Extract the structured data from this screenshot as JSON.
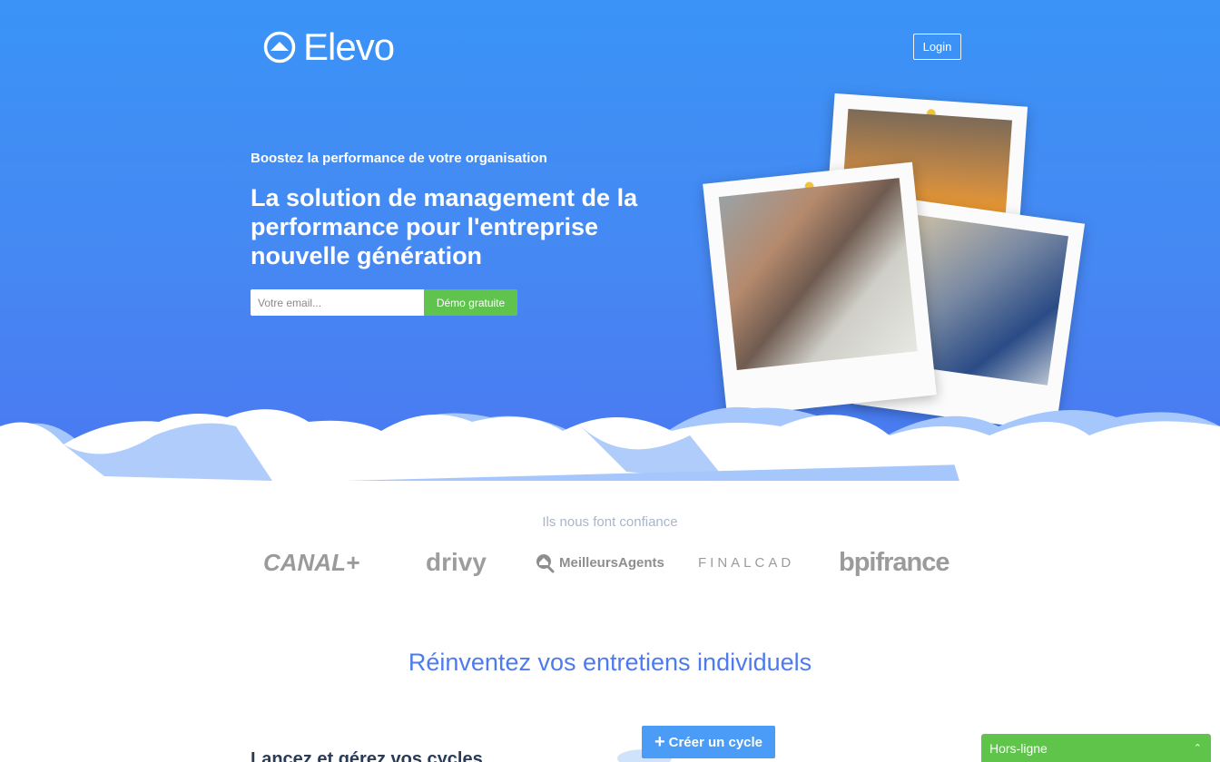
{
  "brand": {
    "name": "Elevo",
    "icon": "elevo-logo-icon"
  },
  "header": {
    "login_label": "Login"
  },
  "hero": {
    "tagline": "Boostez la performance de votre organisation",
    "headline": "La solution de management de la performance pour l'entreprise nouvelle génération",
    "email_placeholder": "Votre email...",
    "cta_label": "Démo gratuite"
  },
  "trust": {
    "title": "Ils nous font confiance",
    "logos": [
      "CANAL+",
      "drivy",
      "MeilleursAgents",
      "FINALCAD",
      "bpifrance"
    ]
  },
  "section": {
    "title": "Réinventez vos entretiens individuels",
    "sub_heading": "Lancez et gérez vos cycles",
    "create_cycle_label": "Créer un cycle"
  },
  "chat": {
    "status_label": "Hors-ligne",
    "toggle_icon": "chevron-up-icon"
  },
  "colors": {
    "hero_top": "#3a93f6",
    "hero_bottom": "#4a78f0",
    "cta_green": "#5fc34d",
    "accent_blue": "#4d7bef"
  }
}
